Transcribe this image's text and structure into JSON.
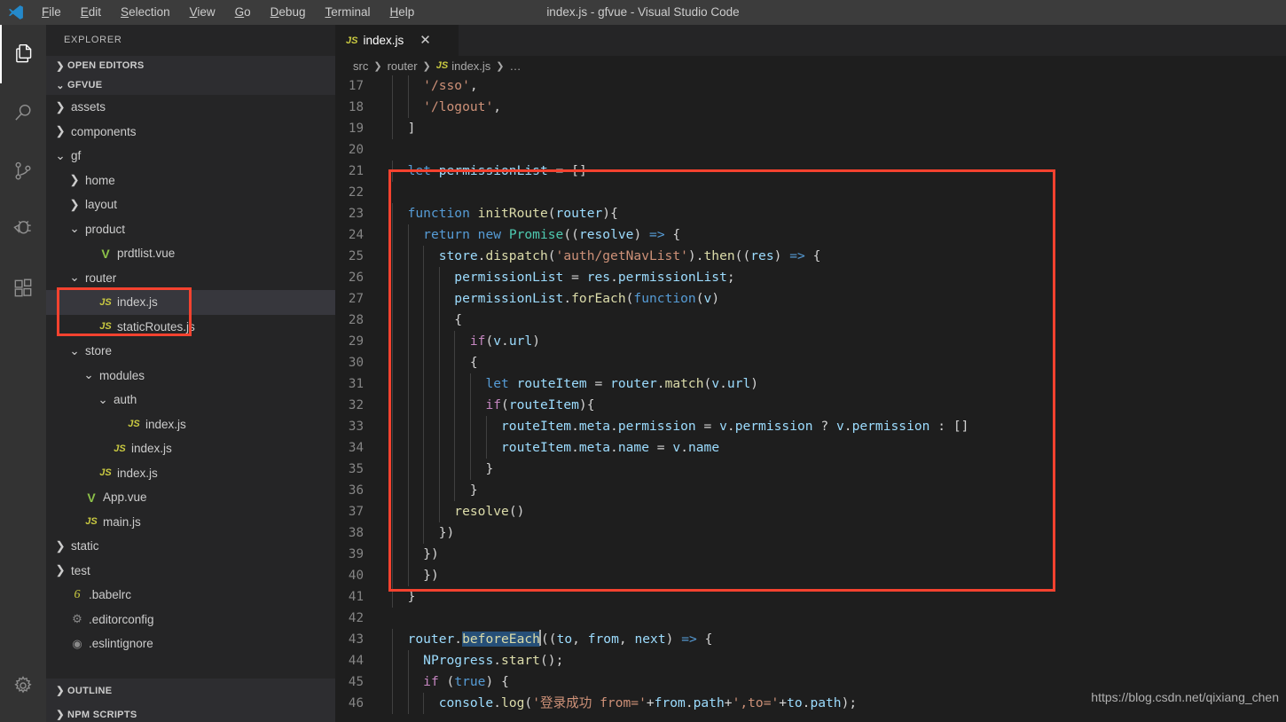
{
  "window": {
    "title": "index.js - gfvue - Visual Studio Code",
    "logo_icon": "vscode-logo-icon"
  },
  "menu": {
    "items": [
      {
        "label": "File",
        "accel": "F"
      },
      {
        "label": "Edit",
        "accel": "E"
      },
      {
        "label": "Selection",
        "accel": "S"
      },
      {
        "label": "View",
        "accel": "V"
      },
      {
        "label": "Go",
        "accel": "G"
      },
      {
        "label": "Debug",
        "accel": "D"
      },
      {
        "label": "Terminal",
        "accel": "T"
      },
      {
        "label": "Help",
        "accel": "H"
      }
    ]
  },
  "activity_bar": {
    "items": [
      {
        "name": "explorer-icon",
        "active": true
      },
      {
        "name": "search-icon",
        "active": false
      },
      {
        "name": "source-control-icon",
        "active": false
      },
      {
        "name": "debug-icon",
        "active": false
      },
      {
        "name": "extensions-icon",
        "active": false
      }
    ],
    "bottom": {
      "name": "settings-gear-icon"
    }
  },
  "sidebar": {
    "title": "EXPLORER",
    "sections": {
      "open_editors": "OPEN EDITORS",
      "project": "GFVUE",
      "outline": "OUTLINE",
      "npm_scripts": "NPM SCRIPTS"
    },
    "tree": [
      {
        "label": "assets",
        "depth": 1,
        "kind": "folder",
        "expanded": false
      },
      {
        "label": "components",
        "depth": 1,
        "kind": "folder",
        "expanded": false
      },
      {
        "label": "gf",
        "depth": 1,
        "kind": "folder",
        "expanded": true
      },
      {
        "label": "home",
        "depth": 2,
        "kind": "folder",
        "expanded": false
      },
      {
        "label": "layout",
        "depth": 2,
        "kind": "folder",
        "expanded": false
      },
      {
        "label": "product",
        "depth": 2,
        "kind": "folder",
        "expanded": true
      },
      {
        "label": "prdtlist.vue",
        "depth": 3,
        "kind": "vue"
      },
      {
        "label": "router",
        "depth": 2,
        "kind": "folder",
        "expanded": true,
        "highlighted": true
      },
      {
        "label": "index.js",
        "depth": 3,
        "kind": "js",
        "selected": true,
        "highlighted": true
      },
      {
        "label": "staticRoutes.js",
        "depth": 3,
        "kind": "js"
      },
      {
        "label": "store",
        "depth": 2,
        "kind": "folder",
        "expanded": true
      },
      {
        "label": "modules",
        "depth": 3,
        "kind": "folder",
        "expanded": true
      },
      {
        "label": "auth",
        "depth": 4,
        "kind": "folder",
        "expanded": true
      },
      {
        "label": "index.js",
        "depth": 5,
        "kind": "js"
      },
      {
        "label": "index.js",
        "depth": 4,
        "kind": "js"
      },
      {
        "label": "index.js",
        "depth": 3,
        "kind": "js"
      },
      {
        "label": "App.vue",
        "depth": 2,
        "kind": "vue"
      },
      {
        "label": "main.js",
        "depth": 2,
        "kind": "js"
      },
      {
        "label": "static",
        "depth": 1,
        "kind": "folder",
        "expanded": false
      },
      {
        "label": "test",
        "depth": 1,
        "kind": "folder",
        "expanded": false
      },
      {
        "label": ".babelrc",
        "depth": 1,
        "kind": "babel"
      },
      {
        "label": ".editorconfig",
        "depth": 1,
        "kind": "gear"
      },
      {
        "label": ".eslintignore",
        "depth": 1,
        "kind": "eslint"
      }
    ]
  },
  "editor": {
    "tab": {
      "label": "index.js",
      "icon": "js-file-icon",
      "close_icon": "close-icon"
    },
    "breadcrumb": [
      "src",
      "router",
      "index.js",
      "…"
    ],
    "selection_token": "beforeEach",
    "first_line_number": 17,
    "lines": [
      {
        "n": 17,
        "indent": 2,
        "text": "'/sso',"
      },
      {
        "n": 18,
        "indent": 2,
        "text": "'/logout',"
      },
      {
        "n": 19,
        "indent": 1,
        "text": "]"
      },
      {
        "n": 20,
        "indent": 0,
        "text": ""
      },
      {
        "n": 21,
        "indent": 1,
        "text": "let permissionList = []"
      },
      {
        "n": 22,
        "indent": 0,
        "text": ""
      },
      {
        "n": 23,
        "indent": 1,
        "text": "function initRoute(router){"
      },
      {
        "n": 24,
        "indent": 2,
        "text": "return new Promise((resolve) => {"
      },
      {
        "n": 25,
        "indent": 3,
        "text": "store.dispatch('auth/getNavList').then((res) => {"
      },
      {
        "n": 26,
        "indent": 4,
        "text": "permissionList = res.permissionList;"
      },
      {
        "n": 27,
        "indent": 4,
        "text": "permissionList.forEach(function(v)"
      },
      {
        "n": 28,
        "indent": 4,
        "text": "{"
      },
      {
        "n": 29,
        "indent": 5,
        "text": "if(v.url)"
      },
      {
        "n": 30,
        "indent": 5,
        "text": "{"
      },
      {
        "n": 31,
        "indent": 6,
        "text": "let routeItem = router.match(v.url)"
      },
      {
        "n": 32,
        "indent": 6,
        "text": "if(routeItem){"
      },
      {
        "n": 33,
        "indent": 7,
        "text": "routeItem.meta.permission = v.permission ? v.permission : []"
      },
      {
        "n": 34,
        "indent": 7,
        "text": "routeItem.meta.name = v.name"
      },
      {
        "n": 35,
        "indent": 6,
        "text": "}"
      },
      {
        "n": 36,
        "indent": 5,
        "text": "}"
      },
      {
        "n": 37,
        "indent": 4,
        "text": "resolve()"
      },
      {
        "n": 38,
        "indent": 3,
        "text": "})"
      },
      {
        "n": 39,
        "indent": 2,
        "text": "})"
      },
      {
        "n": 40,
        "indent": 2,
        "text": "})"
      },
      {
        "n": 41,
        "indent": 1,
        "text": "}"
      },
      {
        "n": 42,
        "indent": 0,
        "text": ""
      },
      {
        "n": 43,
        "indent": 1,
        "text": "router.beforeEach((to, from, next) => {"
      },
      {
        "n": 44,
        "indent": 2,
        "text": "NProgress.start();"
      },
      {
        "n": 45,
        "indent": 2,
        "text": "if (true) {"
      },
      {
        "n": 46,
        "indent": 3,
        "text": "console.log('登录成功 from='+from.path+',to='+to.path);"
      }
    ]
  },
  "annotations": {
    "code_highlight_box": {
      "color": "#f4422f",
      "lines": "23-41"
    },
    "tree_highlight_box": {
      "color": "#f4422f",
      "items": "router / index.js"
    }
  },
  "watermark": "https://blog.csdn.net/qixiang_chen",
  "colors": {
    "accent": "#007acc",
    "titlebar_bg": "#3c3c3c",
    "sidebar_bg": "#252526",
    "editor_bg": "#1e1e1e",
    "highlight_red": "#f4422f",
    "selection_blue": "#264f78"
  }
}
